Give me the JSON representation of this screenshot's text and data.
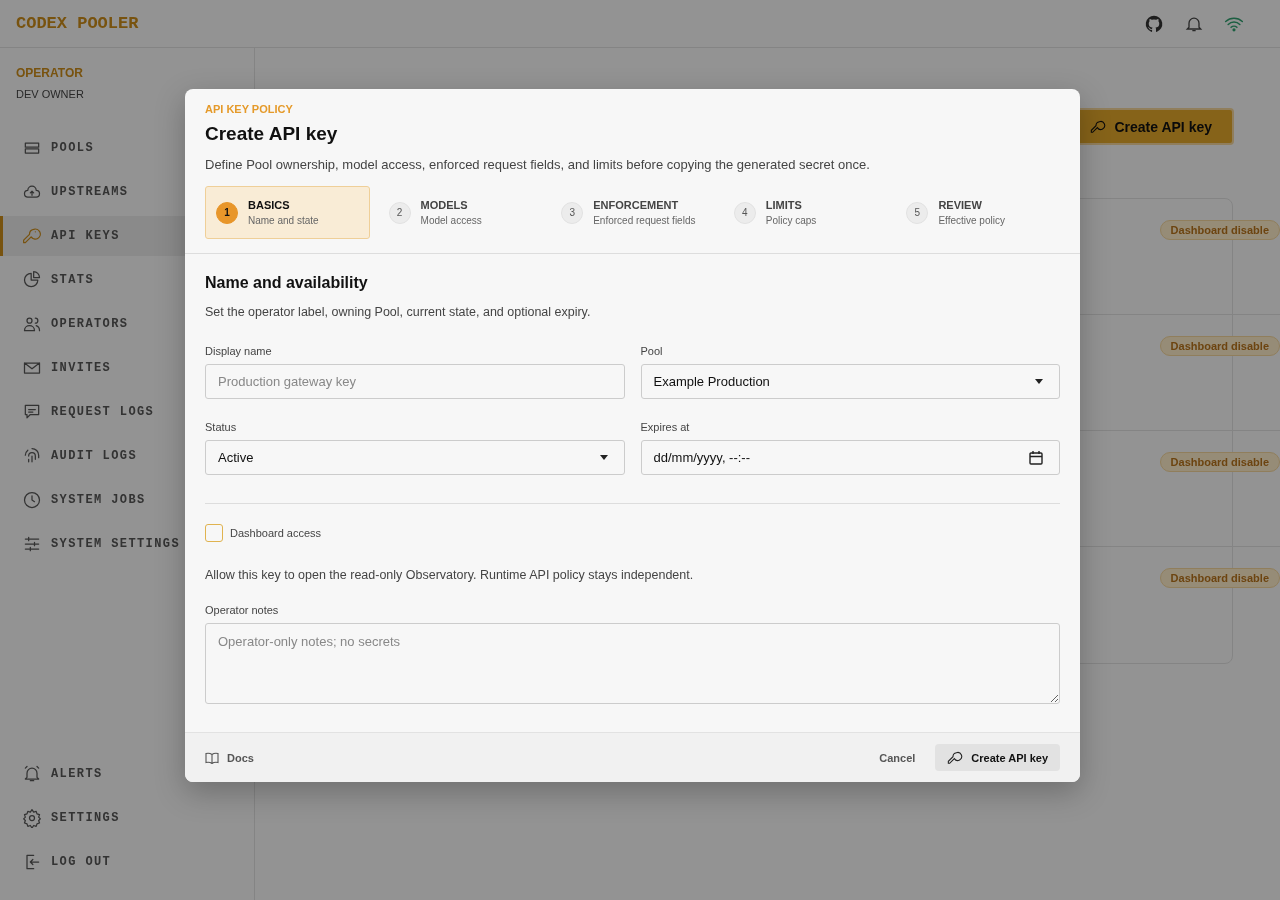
{
  "brand": "CODEX POOLER",
  "operator": {
    "role": "OPERATOR",
    "name": "DEV OWNER"
  },
  "nav": [
    {
      "label": "POOLS",
      "selected": false
    },
    {
      "label": "UPSTREAMS",
      "selected": false
    },
    {
      "label": "API KEYS",
      "selected": true
    },
    {
      "label": "STATS",
      "selected": false
    },
    {
      "label": "OPERATORS",
      "selected": false
    },
    {
      "label": "INVITES",
      "selected": false
    },
    {
      "label": "REQUEST LOGS",
      "selected": false
    },
    {
      "label": "AUDIT LOGS",
      "selected": false
    },
    {
      "label": "SYSTEM JOBS",
      "selected": false
    },
    {
      "label": "SYSTEM SETTINGS",
      "selected": false
    }
  ],
  "nav_bottom": [
    {
      "label": "ALERTS"
    },
    {
      "label": "SETTINGS"
    },
    {
      "label": "LOG OUT"
    }
  ],
  "create_button": "Create API key",
  "key_rows": [
    {
      "badge": "Dashboard disable"
    },
    {
      "badge": "Dashboard disable"
    },
    {
      "badge": "Dashboard disable"
    },
    {
      "badge": "Dashboard disable"
    }
  ],
  "modal": {
    "eyebrow": "API KEY POLICY",
    "title": "Create API key",
    "description": "Define Pool ownership, model access, enforced request fields, and limits before copying the generated secret once.",
    "steps": [
      {
        "number": "1",
        "title": "BASICS",
        "subtitle": "Name and state",
        "selected": true
      },
      {
        "number": "2",
        "title": "MODELS",
        "subtitle": "Model access",
        "selected": false
      },
      {
        "number": "3",
        "title": "ENFORCEMENT",
        "subtitle": "Enforced request fields",
        "selected": false
      },
      {
        "number": "4",
        "title": "LIMITS",
        "subtitle": "Policy caps",
        "selected": false
      },
      {
        "number": "5",
        "title": "REVIEW",
        "subtitle": "Effective policy",
        "selected": false
      }
    ],
    "section_title": "Name and availability",
    "section_description": "Set the operator label, owning Pool, current state, and optional expiry.",
    "display_name": {
      "label": "Display name",
      "placeholder": "Production gateway key"
    },
    "pool": {
      "label": "Pool",
      "value": "Example Production"
    },
    "status": {
      "label": "Status",
      "value": "Active"
    },
    "expires": {
      "label": "Expires at",
      "value": "dd/mm/yyyy, --:--"
    },
    "dashboard_access": {
      "label": "Dashboard access",
      "checked": false
    },
    "dashboard_help": "Allow this key to open the read-only Observatory. Runtime API policy stays independent.",
    "notes": {
      "label": "Operator notes",
      "placeholder": "Operator-only notes; no secrets"
    },
    "docs": "Docs",
    "cancel": "Cancel",
    "submit": "Create API key"
  }
}
